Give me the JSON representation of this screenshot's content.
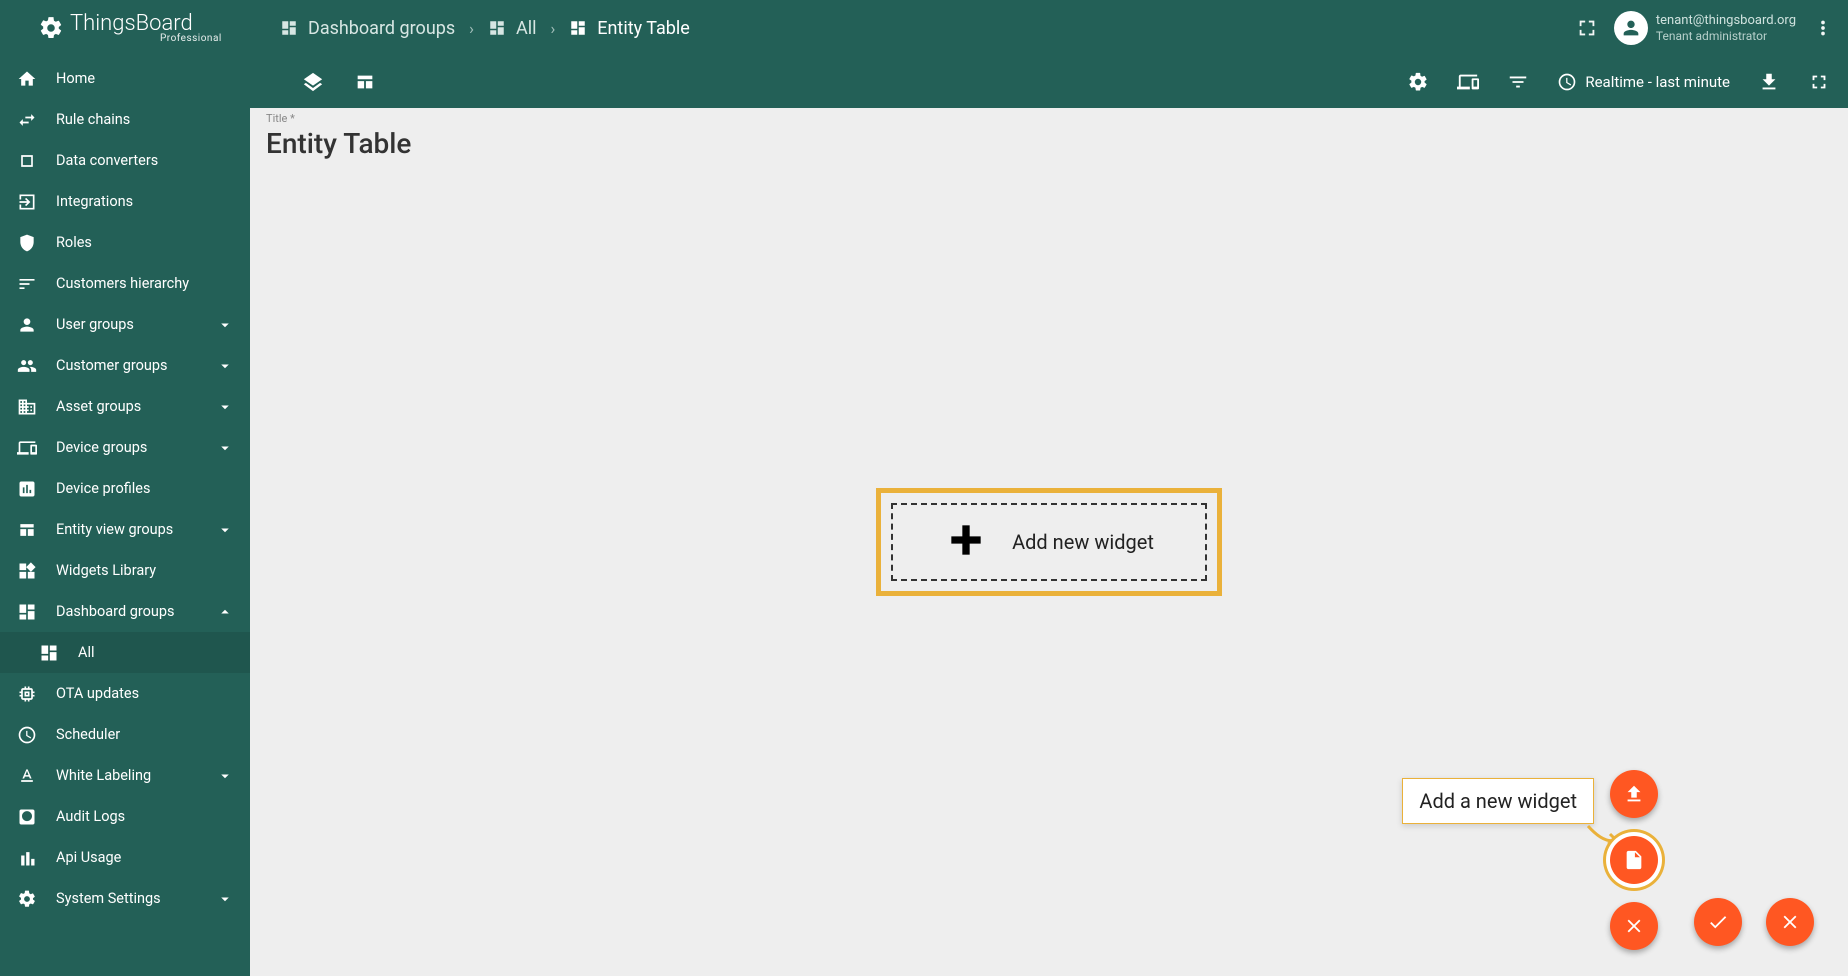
{
  "app": {
    "name": "ThingsBoard",
    "edition": "Professional"
  },
  "breadcrumb": {
    "groups": "Dashboard groups",
    "all": "All",
    "current": "Entity Table"
  },
  "user": {
    "email": "tenant@thingsboard.org",
    "role": "Tenant administrator"
  },
  "sidebar": {
    "home": "Home",
    "rule_chains": "Rule chains",
    "data_converters": "Data converters",
    "integrations": "Integrations",
    "roles": "Roles",
    "customers_hierarchy": "Customers hierarchy",
    "user_groups": "User groups",
    "customer_groups": "Customer groups",
    "asset_groups": "Asset groups",
    "device_groups": "Device groups",
    "device_profiles": "Device profiles",
    "entity_view_groups": "Entity view groups",
    "widgets_library": "Widgets Library",
    "dashboard_groups": "Dashboard groups",
    "dashboard_all": "All",
    "ota_updates": "OTA updates",
    "scheduler": "Scheduler",
    "white_labeling": "White Labeling",
    "audit_logs": "Audit Logs",
    "api_usage": "Api Usage",
    "system_settings": "System Settings"
  },
  "toolbar": {
    "realtime": "Realtime - last minute"
  },
  "dashboard": {
    "title_label": "Title *",
    "title_value": "Entity Table",
    "add_widget": "Add new widget"
  },
  "tooltip": {
    "add_widget": "Add a new widget"
  }
}
